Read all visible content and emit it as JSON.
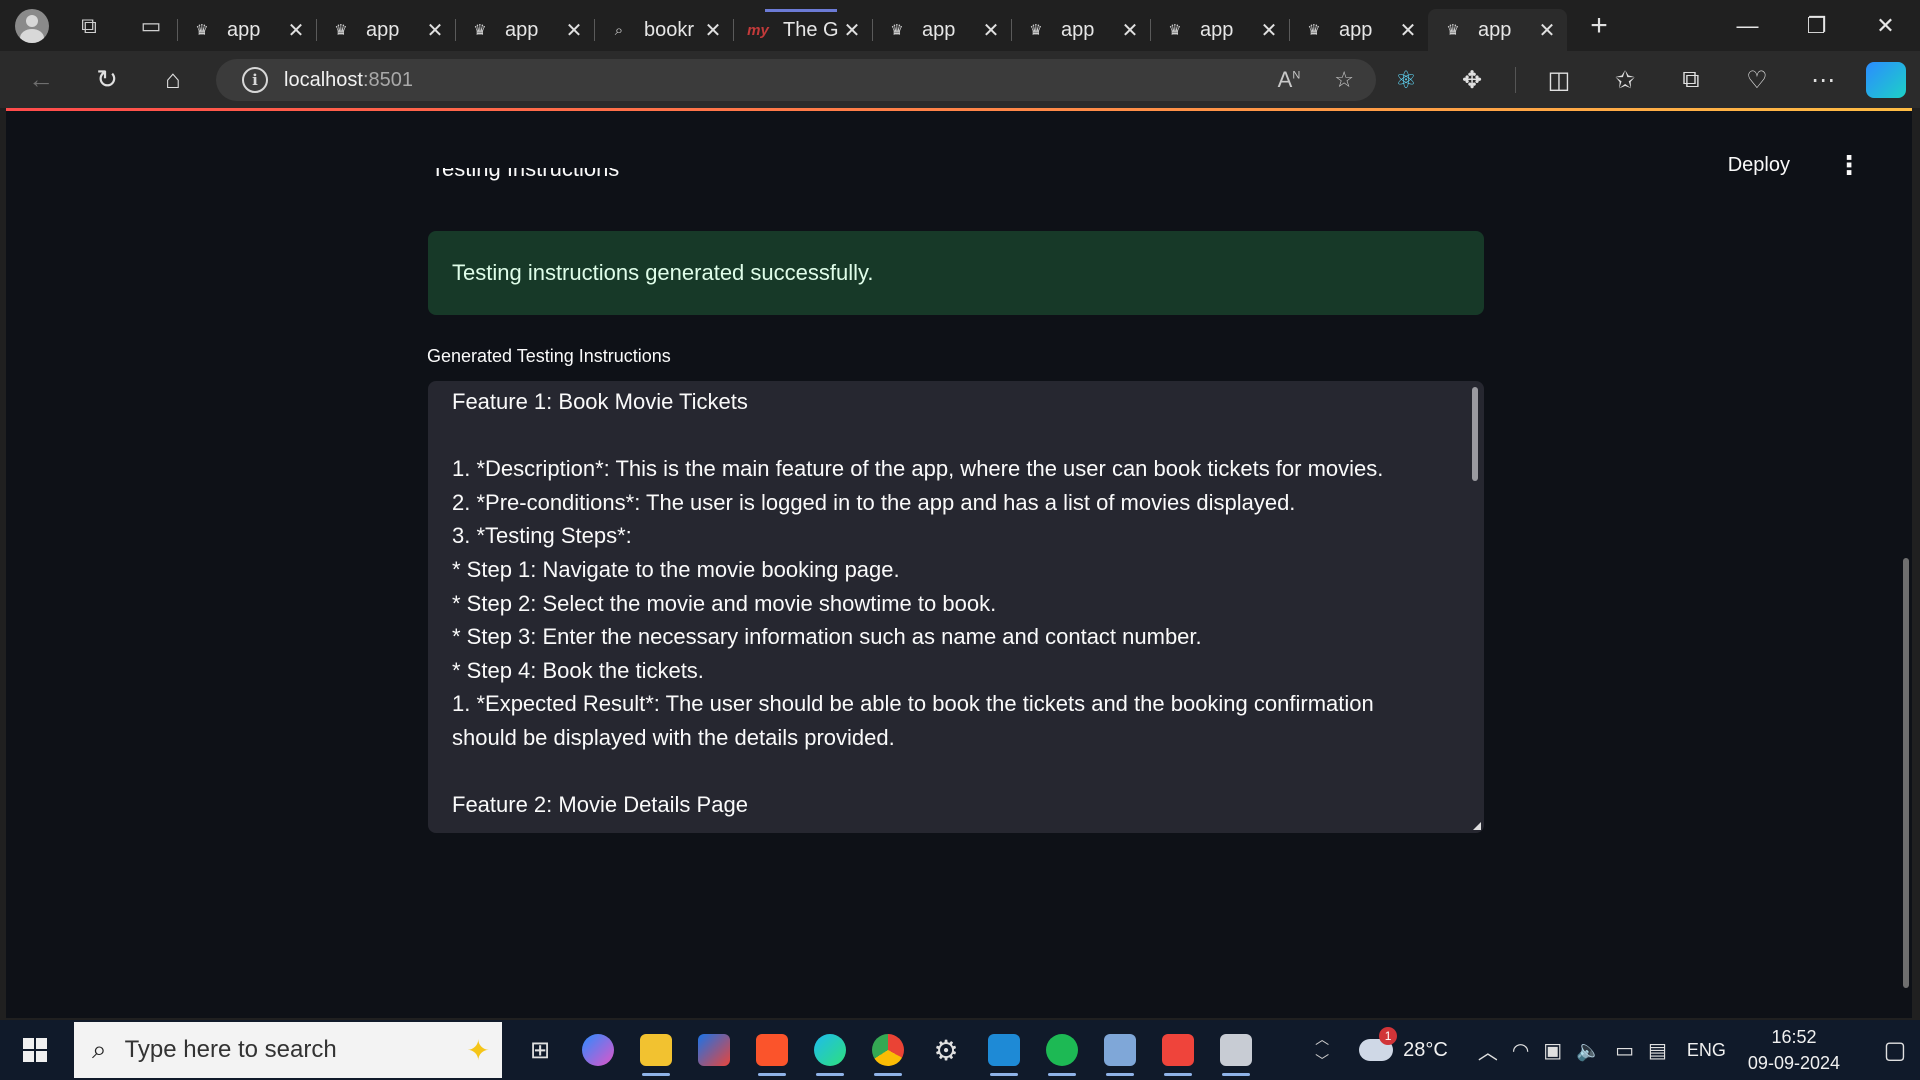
{
  "browser": {
    "tabs": [
      {
        "label": "app",
        "favicon": "streamlit-crown-icon",
        "active": false
      },
      {
        "label": "app",
        "favicon": "streamlit-crown-icon",
        "active": false
      },
      {
        "label": "app",
        "favicon": "streamlit-crown-icon",
        "active": false
      },
      {
        "label": "bookr",
        "favicon": "search-icon",
        "active": false
      },
      {
        "label": "The G",
        "favicon": "my-icon",
        "active": false
      },
      {
        "label": "app",
        "favicon": "streamlit-crown-icon",
        "active": false
      },
      {
        "label": "app",
        "favicon": "streamlit-crown-icon",
        "active": false
      },
      {
        "label": "app",
        "favicon": "streamlit-crown-icon",
        "active": false
      },
      {
        "label": "app",
        "favicon": "streamlit-crown-icon",
        "active": false
      },
      {
        "label": "app",
        "favicon": "streamlit-crown-icon",
        "active": true
      }
    ],
    "my_favicon_text": "my",
    "address": {
      "host": "localhost",
      "port": ":8501"
    },
    "read_aloud_label": "A",
    "read_aloud_superscript": "N"
  },
  "app": {
    "header": {
      "deploy_label": "Deploy"
    },
    "partial_text": "Testing Instructions",
    "success_message": "Testing instructions generated successfully.",
    "textarea_label": "Generated Testing Instructions",
    "textarea_value": "Feature 1: Book Movie Tickets\n\n1. *Description*: This is the main feature of the app, where the user can book tickets for movies.\n2. *Pre-conditions*: The user is logged in to the app and has a list of movies displayed.\n3. *Testing Steps*:\n* Step 1: Navigate to the movie booking page.\n* Step 2: Select the movie and movie showtime to book.\n* Step 3: Enter the necessary information such as name and contact number.\n* Step 4: Book the tickets.\n1. *Expected Result*: The user should be able to book the tickets and the booking confirmation should be displayed with the details provided.\n\nFeature 2: Movie Details Page",
    "colors": {
      "background": "#0e1117",
      "success_bg": "#173928",
      "textarea_bg": "#262730"
    }
  },
  "taskbar": {
    "search_placeholder": "Type here to search",
    "weather": {
      "temp": "28°C",
      "badge": "1"
    },
    "language": "ENG",
    "time": "16:52",
    "date": "09-09-2024"
  }
}
